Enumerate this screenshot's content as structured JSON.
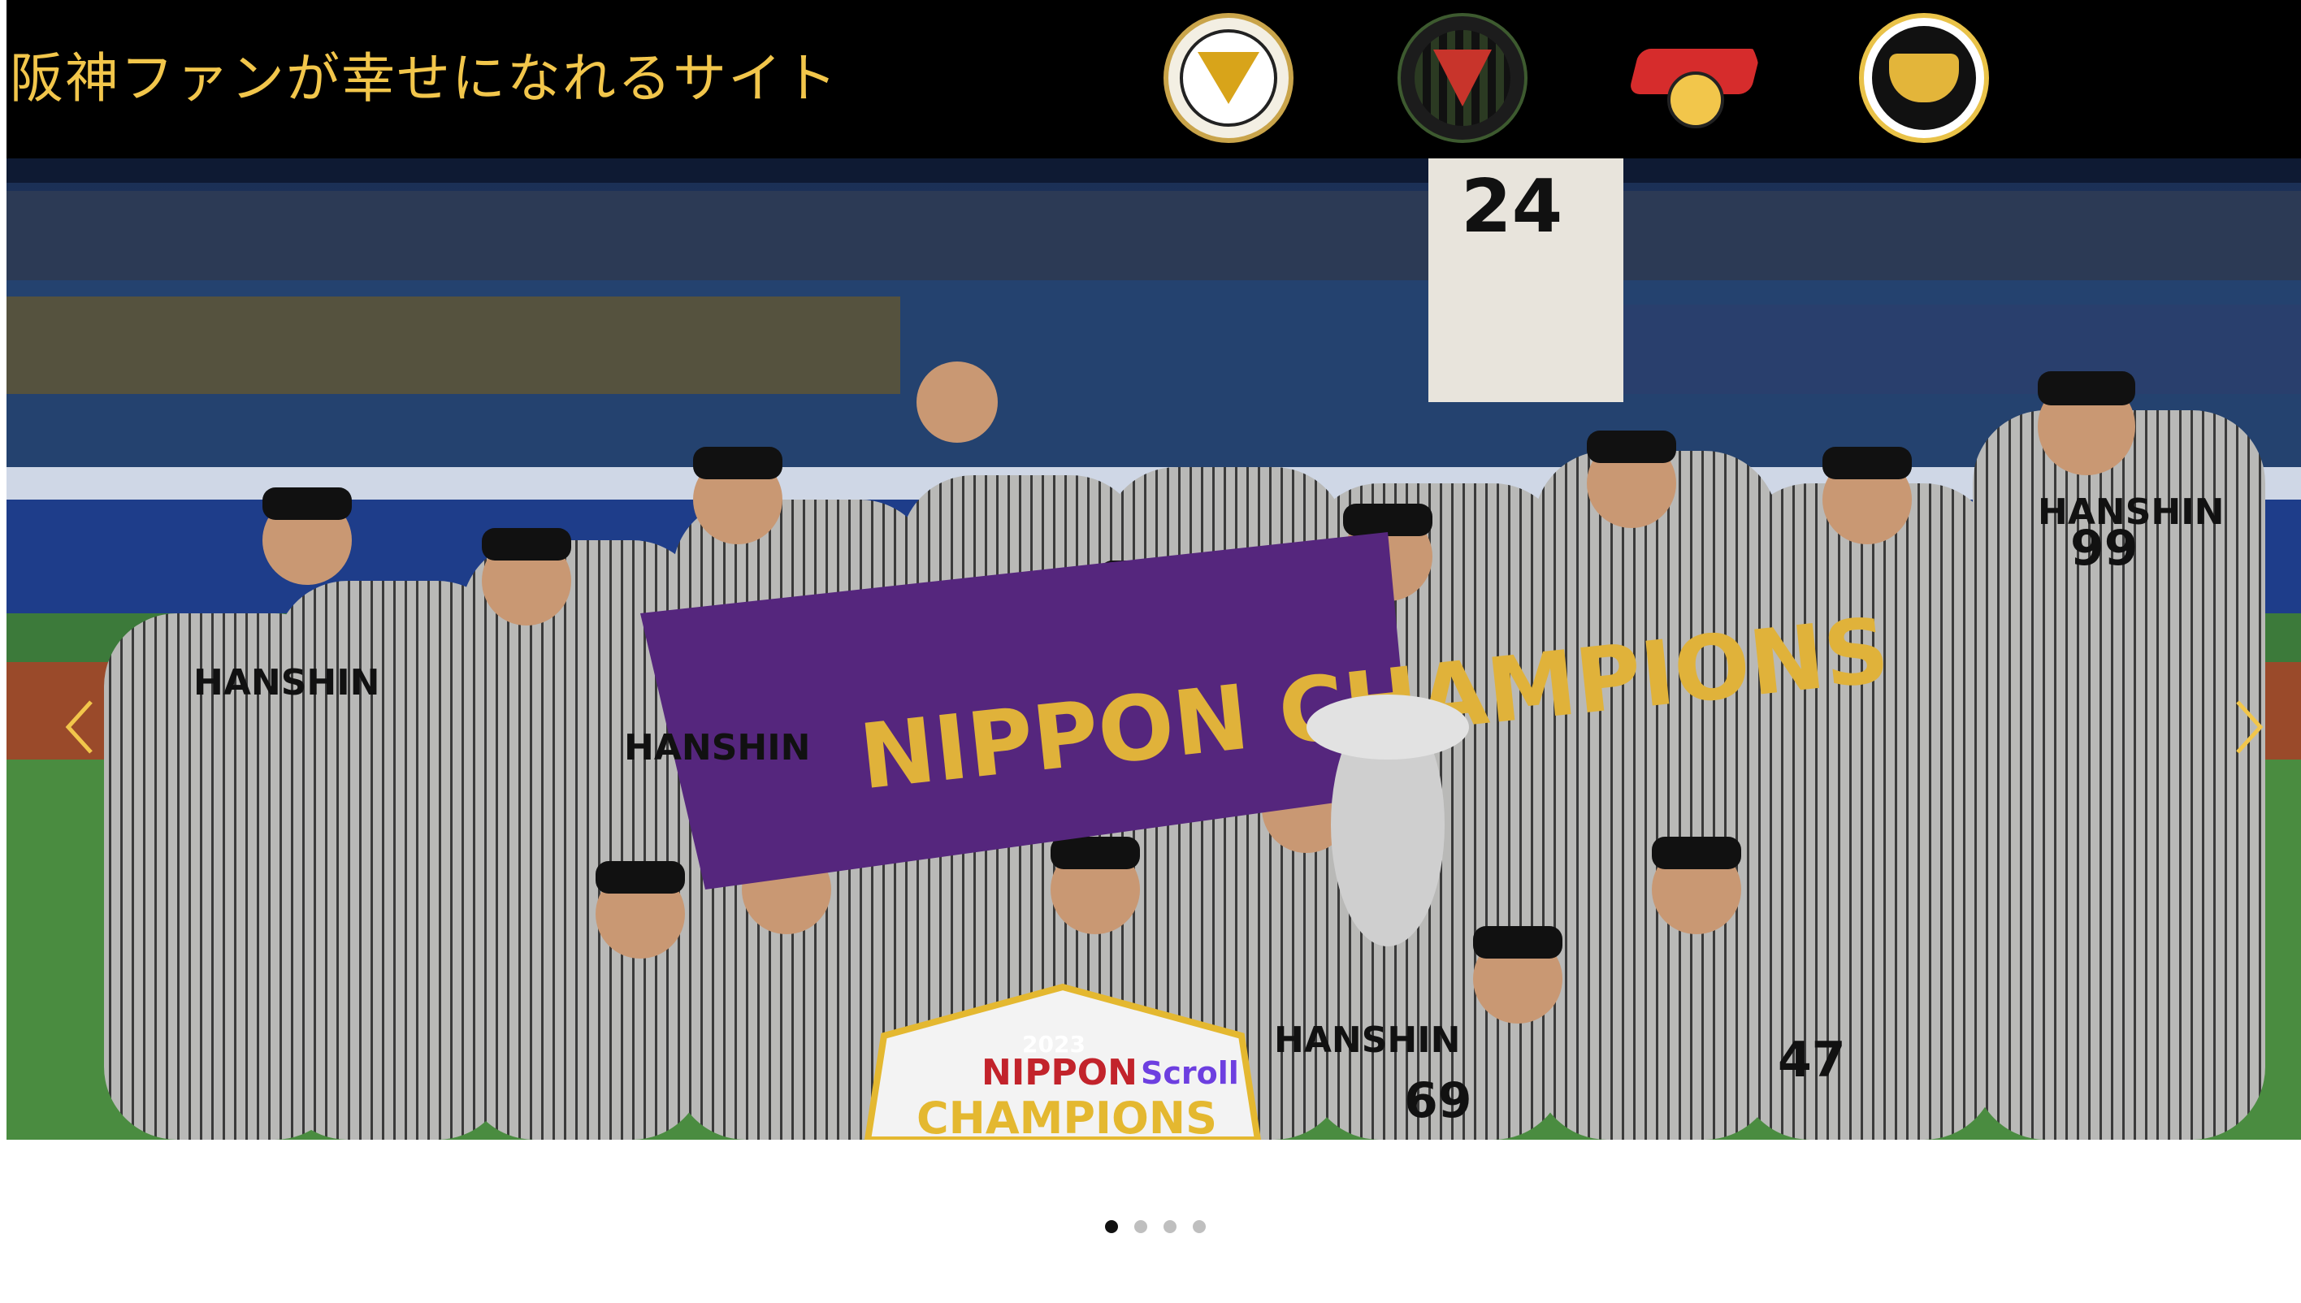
{
  "header": {
    "title": "阪神ファンが幸せになれるサイト",
    "logos": [
      {
        "name": "tigers-victory-logo"
      },
      {
        "name": "hanshin-tigers-2003-logo"
      },
      {
        "name": "tigers-2005-central-league-champions-logo"
      },
      {
        "name": "jera-central-league-champions-2023-are-logo"
      }
    ]
  },
  "carousel": {
    "overlay_text": "Scroll",
    "slide_count": 4,
    "active_slide": 1,
    "banner_text": "NIPPON CHAMPIONS",
    "sign_year": "2023",
    "sign_text_1": "NIPPON",
    "sign_text_2": "CHAMPIONS",
    "jersey_numbers": [
      "24",
      "99",
      "47",
      "69"
    ],
    "team_text": "HANSHIN"
  },
  "colors": {
    "header_bg": "#000000",
    "title_gold": "#f2c64b",
    "scroll_purple": "#6d3fe0",
    "dot_active": "#111111",
    "dot_inactive": "#bfbfbf"
  }
}
